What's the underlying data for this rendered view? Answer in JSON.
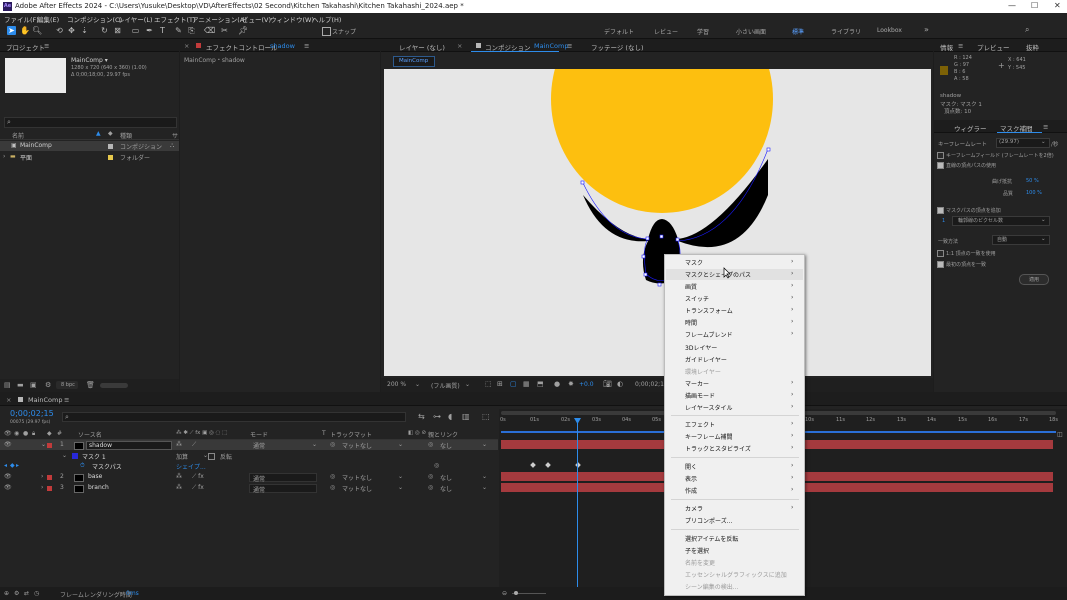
{
  "window": {
    "title": "Adobe After Effects 2024 - C:\\Users\\Yusuke\\Desktop\\VD\\AfterEffects\\02 Second\\Kitchen Takahashi\\Kitchen Takahashi_2024.aep *",
    "logo": "Ae"
  },
  "menu": [
    "ファイル(F)",
    "編集(E)",
    "コンポジション(C)",
    "レイヤー(L)",
    "エフェクト(T)",
    "アニメーション(A)",
    "ビュー(V)",
    "ウィンドウ(W)",
    "ヘルプ(H)"
  ],
  "toolbar": {
    "snap_label": "スナップ",
    "workspaces": [
      "デフォルト",
      "レビュー",
      "学習",
      "小さい画面",
      "標準",
      "ライブラリ",
      "Lookbox"
    ],
    "active_workspace": "標準"
  },
  "project": {
    "tab": "プロジェクト",
    "thumb_name": "MainComp ▾",
    "thumb_info": [
      "1280 x 720 (640 x 360) (1.00)",
      "Δ 0;00;18;00, 29.97 fps"
    ],
    "search_placeholder": "",
    "col_name": "名前",
    "col_type": "種類",
    "items": [
      {
        "name": "MainComp",
        "type": "コンポジション",
        "color": "#b7b7b7"
      },
      {
        "name": "平面",
        "type": "フォルダー",
        "color": "#e6c84c"
      }
    ],
    "footer_bpc": "8 bpc"
  },
  "effect_controls": {
    "tab": "エフェクトコントロール",
    "layer": "shadow",
    "path": "MainComp・shadow"
  },
  "viewer": {
    "tabs": [
      "レイヤー (なし)",
      "コンポジション MainComp",
      "フッテージ (なし)"
    ],
    "comp_tab_prefix": "コンポジション",
    "comp_tab_name": "MainComp",
    "breadcrumb": "MainComp",
    "zoom": "200 %",
    "quality": "(フル画質)",
    "exposure": "+0.0",
    "timecode": "0;00;02;15"
  },
  "info": {
    "tabs": [
      "情報",
      "プレビュー",
      "抜粋"
    ],
    "R": "R : 124",
    "G": "G : 97",
    "B": "B : 6",
    "A": "A : 58",
    "X": "X : 641",
    "Y": "Y : 545",
    "lines": [
      "shadow",
      "マスク: マスク 1",
      "頂点数: 10"
    ]
  },
  "mask_panel": {
    "tabs": [
      "ウィグラー",
      "マスク補間"
    ],
    "keyframe_rate_label": "キーフレームレート",
    "keyframe_rate": "(29.97)",
    "keyframe_rate_unit": "/秒",
    "opt1": "キーフレームフィールド (フレームレートを2倍)",
    "opt2": "直線の頂点パスの使用",
    "bend_label": "曲げ抵抗",
    "bend_value": "50 %",
    "quality_label": "品質",
    "quality_value": "100 %",
    "opt3": "マスクパスの頂点を追加",
    "vertex_value": "1",
    "vertex_mode": "輪郭線のピクセル数",
    "match_label": "一致方法",
    "match_value": "自動",
    "opt4": "1:1 頂点の一致を使用",
    "opt5": "最初の頂点を一致",
    "apply": "適用"
  },
  "timeline": {
    "tab": "MainComp",
    "timecode": "0;00;02;15",
    "fps": "00075 (29.97 fps)",
    "headers": [
      "ソース名",
      "モード",
      "トラックマット",
      "親とリンク"
    ],
    "ruler": [
      "0s",
      "01s",
      "02s",
      "03s",
      "04s",
      "05s",
      "06s",
      "07s",
      "08s",
      "09s",
      "10s",
      "11s",
      "12s",
      "13s",
      "14s",
      "15s",
      "16s",
      "17s",
      "18s"
    ],
    "layers": [
      {
        "num": "1",
        "name": "shadow",
        "mode": "通常",
        "matte": "マットなし",
        "parent": "なし",
        "color": "#c23b3b"
      },
      {
        "num": "2",
        "name": "base",
        "mode": "通常",
        "matte": "マットなし",
        "parent": "なし",
        "color": "#c23b3b"
      },
      {
        "num": "3",
        "name": "branch",
        "mode": "通常",
        "matte": "マットなし",
        "parent": "なし",
        "color": "#c23b3b"
      }
    ],
    "mask_row": {
      "name": "マスク 1",
      "mode": "加算",
      "invert": "反転"
    },
    "path_row": {
      "name": "マスクパス",
      "value": "シェイプ..."
    },
    "footer": "フレームレンダリング時間",
    "footer_value": "0ms"
  },
  "context_menu": {
    "items": [
      {
        "label": "マスク",
        "sub": true
      },
      {
        "label": "マスクとシェイプのパス",
        "sub": true,
        "hover": true
      },
      {
        "label": "画質",
        "sub": true
      },
      {
        "label": "スイッチ",
        "sub": true
      },
      {
        "label": "トランスフォーム",
        "sub": true
      },
      {
        "label": "時間",
        "sub": true
      },
      {
        "label": "フレームブレンド",
        "sub": true
      },
      {
        "label": "3Dレイヤー"
      },
      {
        "label": "ガイドレイヤー"
      },
      {
        "label": "環境レイヤー",
        "disabled": true
      },
      {
        "label": "マーカー",
        "sub": true
      },
      {
        "label": "描画モード",
        "sub": true
      },
      {
        "label": "レイヤースタイル",
        "sub": true
      },
      {
        "label": "エフェクト",
        "sub": true,
        "sep_before": true
      },
      {
        "label": "キーフレーム補間",
        "sub": true
      },
      {
        "label": "トラックとスタビライズ",
        "sub": true
      },
      {
        "label": "開く",
        "sub": true,
        "sep_before": true
      },
      {
        "label": "表示",
        "sub": true
      },
      {
        "label": "作成",
        "sub": true
      },
      {
        "label": "カメラ",
        "sub": true,
        "sep_before": true
      },
      {
        "label": "プリコンポーズ..."
      },
      {
        "label": "選択アイテムを反転",
        "sep_before": true
      },
      {
        "label": "子を選択"
      },
      {
        "label": "名前を変更",
        "disabled": true
      },
      {
        "label": "エッセンシャルグラフィックスに追加",
        "disabled": true
      },
      {
        "label": "シーン編集の検出...",
        "disabled": true
      }
    ]
  },
  "colors": {
    "accent": "#2d8ceb",
    "comp_bg": "#e6e6e6",
    "yellow": "#fdbf0f",
    "layer_bar": "#a53a3e",
    "label_red": "#c23b3b",
    "timecode": "#2d8ceb"
  }
}
